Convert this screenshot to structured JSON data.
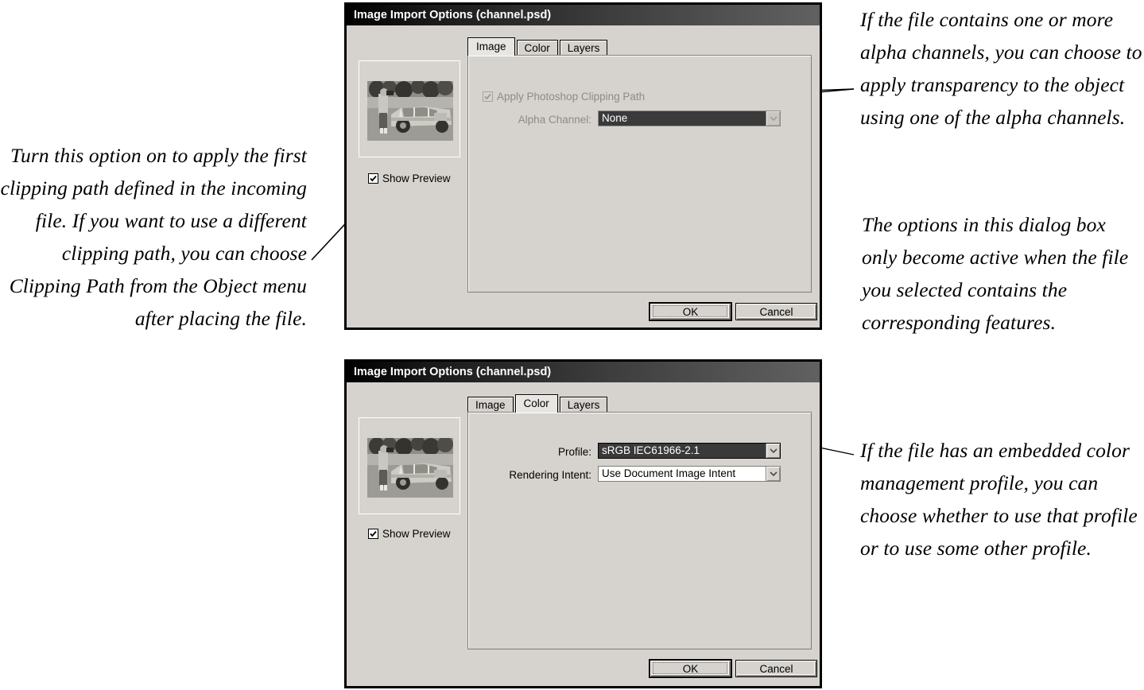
{
  "annotations": {
    "left": [
      "Turn this option on to apply the first clipping path defined in the incoming file. If you want to use a different clipping path, you can choose Clipping Path from the Object menu after placing the file."
    ],
    "right_top": "If the file contains one or more alpha channels, you can choose to apply transparency to the object using one of the alpha channels.",
    "right_middle": "The options in this dialog box only become active when the file you selected contains the corresponding features.",
    "right_bottom": "If the file has an embedded color management profile, you can choose whether to use that profile or to use some other profile."
  },
  "dialog_image": {
    "title": "Image Import Options (channel.psd)",
    "tabs": [
      {
        "label": "Image",
        "active": true
      },
      {
        "label": "Color",
        "active": false
      },
      {
        "label": "Layers",
        "active": false
      }
    ],
    "show_preview": {
      "label": "Show Preview",
      "checked": true,
      "enabled": true
    },
    "apply_clipping_path": {
      "label": "Apply Photoshop Clipping Path",
      "checked": true,
      "enabled": false
    },
    "alpha_channel": {
      "label": "Alpha Channel:",
      "label_accel": "C",
      "value": "None",
      "enabled": false
    },
    "buttons": {
      "ok": "OK",
      "cancel": "Cancel",
      "default": "ok"
    }
  },
  "dialog_color": {
    "title": "Image Import Options (channel.psd)",
    "tabs": [
      {
        "label": "Image",
        "active": false
      },
      {
        "label": "Color",
        "active": true
      },
      {
        "label": "Layers",
        "active": false
      }
    ],
    "show_preview": {
      "label": "Show Preview",
      "checked": true,
      "enabled": true
    },
    "profile": {
      "label": "Profile:",
      "label_accel": "P",
      "value": "sRGB IEC61966-2.1",
      "selected": true
    },
    "rendering_intent": {
      "label": "Rendering Intent:",
      "label_accel": "R",
      "value": "Use Document Image Intent",
      "selected": false
    },
    "buttons": {
      "ok": "OK",
      "cancel": "Cancel",
      "default": "ok"
    }
  },
  "colors": {
    "dialog_face": "#d6d3ce",
    "titlebar_dark": "#000000",
    "titlebar_light": "#616161",
    "disabled_text": "#8e8b87",
    "selection": "#3a3a3a",
    "page_background": "#ffffff"
  }
}
